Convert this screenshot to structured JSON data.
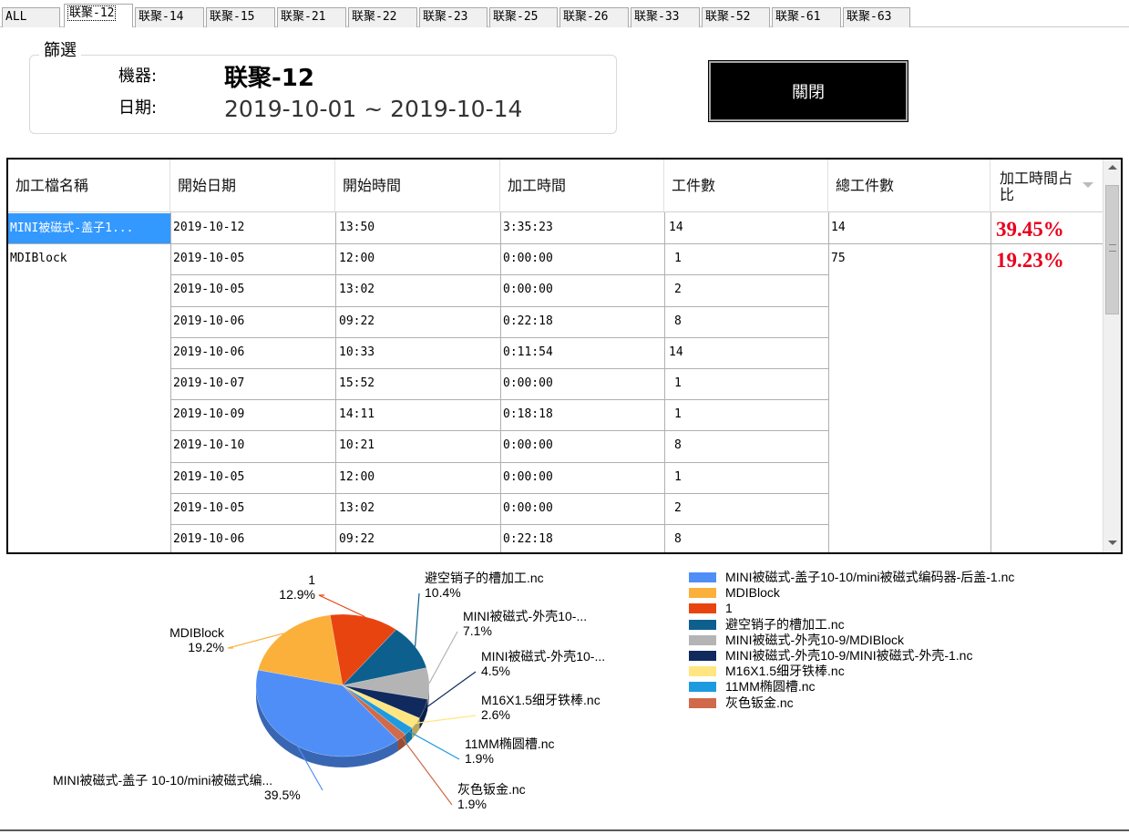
{
  "tabs": [
    "ALL",
    "联聚-12",
    "联聚-14",
    "联聚-15",
    "联聚-21",
    "联聚-22",
    "联聚-23",
    "联聚-25",
    "联聚-26",
    "联聚-33",
    "联聚-52",
    "联聚-61",
    "联聚-63"
  ],
  "active_tab": "联聚-12",
  "filter": {
    "title": "篩選",
    "machine_label": "機器:",
    "machine_value": "联聚-12",
    "date_label": "日期:",
    "date_value": "2019-10-01 ~ 2019-10-14"
  },
  "close_button": "關閉",
  "grid": {
    "headers": [
      "加工檔名稱",
      "開始日期",
      "開始時間",
      "加工時間",
      "工件數",
      "總工件數",
      "加工時間占比"
    ],
    "groups": [
      {
        "file": "MINI被磁式-盖子1...",
        "total": "14",
        "percent": "39.45%",
        "selected": true
      },
      {
        "file": "MDIBlock",
        "total": "75",
        "percent": "19.23%",
        "selected": false
      }
    ],
    "rows": [
      [
        "2019-10-12",
        "13:50",
        "3:35:23",
        "14"
      ],
      [
        "2019-10-05",
        "12:00",
        "0:00:00",
        "1"
      ],
      [
        "2019-10-05",
        "13:02",
        "0:00:00",
        "2"
      ],
      [
        "2019-10-06",
        "09:22",
        "0:22:18",
        "8"
      ],
      [
        "2019-10-06",
        "10:33",
        "0:11:54",
        "14"
      ],
      [
        "2019-10-07",
        "15:52",
        "0:00:00",
        "1"
      ],
      [
        "2019-10-09",
        "14:11",
        "0:18:18",
        "1"
      ],
      [
        "2019-10-10",
        "10:21",
        "0:00:00",
        "8"
      ],
      [
        "2019-10-05",
        "12:00",
        "0:00:00",
        "1"
      ],
      [
        "2019-10-05",
        "13:02",
        "0:00:00",
        "2"
      ],
      [
        "2019-10-06",
        "09:22",
        "0:22:18",
        "8"
      ]
    ]
  },
  "chart_data": {
    "type": "pie",
    "slices": [
      {
        "label": "MINI被磁式-盖子 10-10/mini被磁式编...",
        "value": 39.5,
        "pct_text": "39.5%",
        "color": "#4f8ef7"
      },
      {
        "label": "MDIBlock",
        "value": 19.2,
        "pct_text": "19.2%",
        "color": "#fbb03b"
      },
      {
        "label": "1",
        "value": 12.9,
        "pct_text": "12.9%",
        "color": "#e84410"
      },
      {
        "label": "避空销子的槽加工.nc",
        "value": 10.4,
        "pct_text": "10.4%",
        "color": "#0d5f8e"
      },
      {
        "label": "MINI被磁式-外壳10-...",
        "value": 7.1,
        "pct_text": "7.1%",
        "color": "#b4b4b4"
      },
      {
        "label": "MINI被磁式-外壳10-...",
        "value": 4.5,
        "pct_text": "4.5%",
        "color": "#102a5e"
      },
      {
        "label": "M16X1.5细牙铁棒.nc",
        "value": 2.6,
        "pct_text": "2.6%",
        "color": "#ffe680"
      },
      {
        "label": "11MM椭圆槽.nc",
        "value": 1.9,
        "pct_text": "1.9%",
        "color": "#1e9be0"
      },
      {
        "label": "灰色钣金.nc",
        "value": 1.9,
        "pct_text": "1.9%",
        "color": "#d06a4a"
      }
    ],
    "legend": [
      "MINI被磁式-盖子10-10/mini被磁式编码器-后盖-1.nc",
      "MDIBlock",
      "1",
      "避空销子的槽加工.nc",
      "MINI被磁式-外壳10-9/MDIBlock",
      "MINI被磁式-外壳10-9/MINI被磁式-外壳-1.nc",
      "M16X1.5细牙铁棒.nc",
      "11MM椭圆槽.nc",
      "灰色钣金.nc"
    ],
    "legend_placement": "right"
  }
}
